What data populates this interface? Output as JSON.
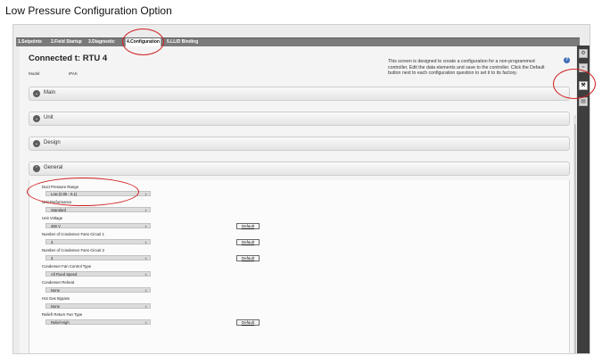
{
  "caption": "Low Pressure Configuration Option",
  "tabs": [
    {
      "label": "1.Setpoints"
    },
    {
      "label": "2.Field Startup"
    },
    {
      "label": "3.Diagnostic"
    },
    {
      "label": "4.Configuration"
    },
    {
      "label": "5.LLID Binding"
    }
  ],
  "header": {
    "title": "Connected t: RTU  4",
    "model_label": "Model:",
    "model_value": "IPAK",
    "info": "This screen is designed to create a configuration for a non-programmed controller. Edit the data elements and save to the controller. Click the Default button next to each configuration question to set it to its factory."
  },
  "sections": [
    {
      "label": "Main"
    },
    {
      "label": "Unit"
    },
    {
      "label": "Design"
    },
    {
      "label": "General"
    }
  ],
  "fields": [
    {
      "label": "Duct Pressure Range",
      "value": "Low (0.05 - 5.1)"
    },
    {
      "label": "Unit Performance",
      "value": "Standard"
    },
    {
      "label": "Unit Voltage",
      "value": "460 V",
      "button": "Default"
    },
    {
      "label": "Number of Condenser Fans Circuit 1",
      "value": "3",
      "button": "Default"
    },
    {
      "label": "Number of Condenser Fans Circuit 2",
      "value": "3",
      "button": "Default"
    },
    {
      "label": "Condenser Fan Control Type",
      "value": "All Fixed Speed"
    },
    {
      "label": "Condenser Reheat",
      "value": "None"
    },
    {
      "label": "Hot Gas Bypass",
      "value": "None"
    },
    {
      "label": "Relief/ Return Fan Type",
      "value": "Relief-High",
      "button": "Default"
    }
  ],
  "right_tools": [
    {
      "icon": "gear-icon"
    },
    {
      "icon": "chart-icon"
    },
    {
      "icon": "wrench-icon"
    },
    {
      "icon": "page-icon"
    }
  ],
  "colors": {
    "annotation": "#d02020",
    "tabbar": "#7a7a7a",
    "tool_strip": "#3e3e3e"
  }
}
